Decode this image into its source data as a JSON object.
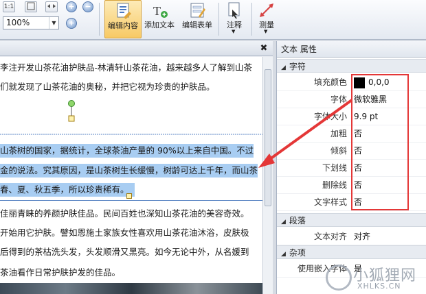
{
  "toolbar": {
    "zoom_value": "100%",
    "btn_fit_label": "1:1",
    "tools": [
      {
        "label": "编辑内容",
        "active": true
      },
      {
        "label": "添加文本",
        "active": false
      },
      {
        "label": "编辑表单",
        "active": false
      },
      {
        "label": "注释",
        "active": false
      },
      {
        "label": "测量",
        "active": false
      }
    ]
  },
  "document": {
    "lines": [
      "李注开发山茶花油护肤品-林清轩山茶花油，越来越多人了解到山茶",
      "们就发现了山茶花油的奥秘，并把它视为珍贵的护肤品。",
      "山茶树的国家，据统计，全球茶油产量的 90%以上来自中国。不过",
      "金的说法。究其原因，是山茶树生长缓慢，树龄可达上千年，而山茶",
      "春、夏、秋五季，所以珍贵稀有。",
      "佳丽青睐的养颜护肤佳品。民间百姓也深知山茶花油的美容奇效。",
      "开始用它护肤。譬如恩施土家族女性喜欢用山茶花油沐浴，皮肤极",
      "后得到的茶枯洗头发，头发顺滑又黑亮。如今无论中外，从名媛到",
      "茶油看作日常护肤护发的佳品。"
    ]
  },
  "properties": {
    "title": "文本 属性",
    "sections": {
      "char": "字符",
      "para": "段落",
      "misc": "杂项"
    },
    "char_rows": [
      {
        "key": "填充颜色",
        "value": "0,0,0"
      },
      {
        "key": "字体",
        "value": "微软雅黑"
      },
      {
        "key": "字体大小",
        "value": "9.9 pt"
      },
      {
        "key": "加粗",
        "value": "否"
      },
      {
        "key": "倾斜",
        "value": "否"
      },
      {
        "key": "下划线",
        "value": "否"
      },
      {
        "key": "删除线",
        "value": "否"
      },
      {
        "key": "文字样式",
        "value": "否"
      }
    ],
    "para_rows": [
      {
        "key": "文本对齐",
        "value": "对齐"
      }
    ],
    "misc_rows": [
      {
        "key": "使用嵌入字体",
        "value": "是"
      }
    ],
    "fill_color": "#000000"
  },
  "watermark": {
    "cn": "小狐狸网",
    "en": "XHLKS.CN"
  },
  "colors": {
    "highlight": "#a8cdf2",
    "annotation_red": "#e43737",
    "active_tool": "#f7c965"
  }
}
